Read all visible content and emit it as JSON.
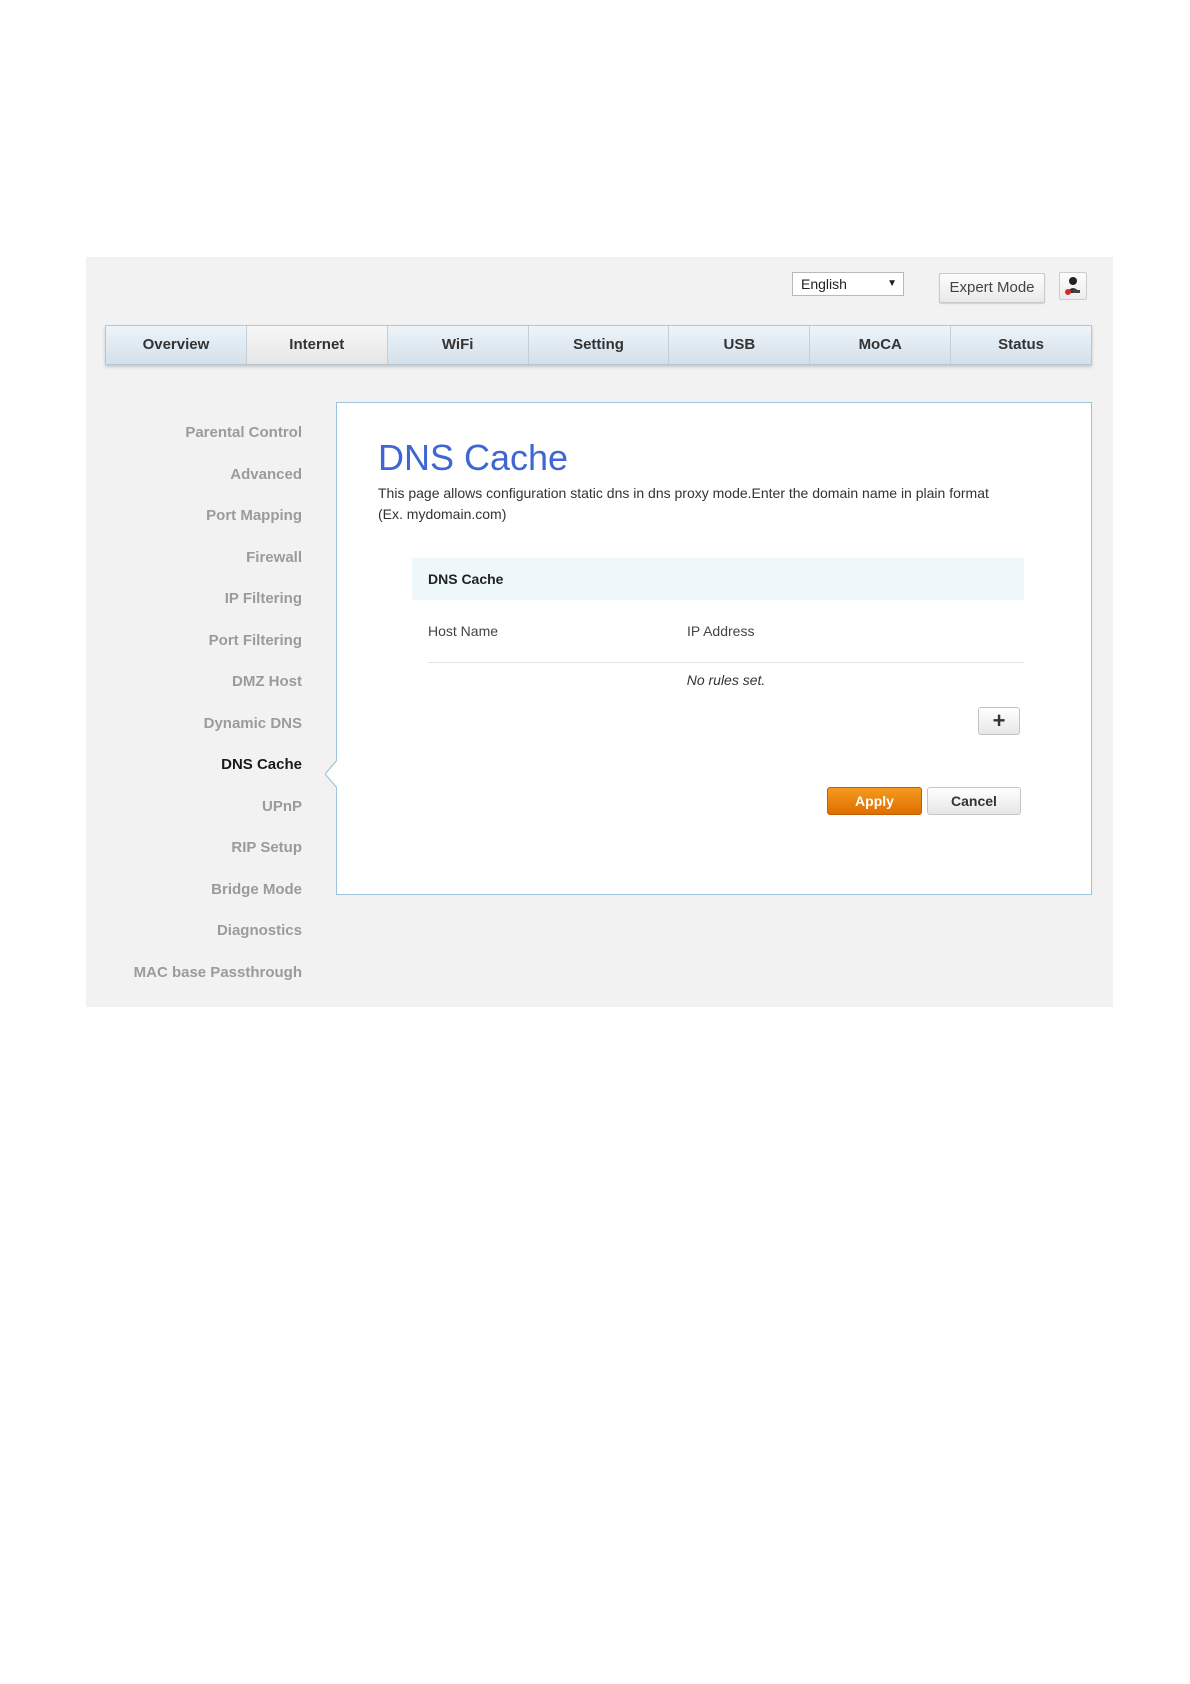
{
  "topbar": {
    "language": "English",
    "expert_mode_label": "Expert Mode"
  },
  "nav": {
    "tabs": [
      "Overview",
      "Internet",
      "WiFi",
      "Setting",
      "USB",
      "MoCA",
      "Status"
    ],
    "active": "Internet"
  },
  "sidebar": {
    "items": [
      "Parental Control",
      "Advanced",
      "Port Mapping",
      "Firewall",
      "IP Filtering",
      "Port Filtering",
      "DMZ Host",
      "Dynamic DNS",
      "DNS Cache",
      "UPnP",
      "RIP Setup",
      "Bridge Mode",
      "Diagnostics",
      "MAC base Passthrough"
    ],
    "active": "DNS Cache"
  },
  "content": {
    "title": "DNS Cache",
    "description_line1": "This page allows configuration static dns in dns proxy mode.Enter the domain name in plain format",
    "description_line2": "(Ex. mydomain.com)",
    "table": {
      "header": "DNS Cache",
      "columns": [
        "Host Name",
        "IP Address"
      ],
      "empty_message": "No rules set."
    },
    "add_button": "+",
    "apply_label": "Apply",
    "cancel_label": "Cancel"
  },
  "colors": {
    "title_blue": "#3f67d4",
    "apply_orange": "#e97e0d",
    "panel_border": "#9cc4dc"
  }
}
